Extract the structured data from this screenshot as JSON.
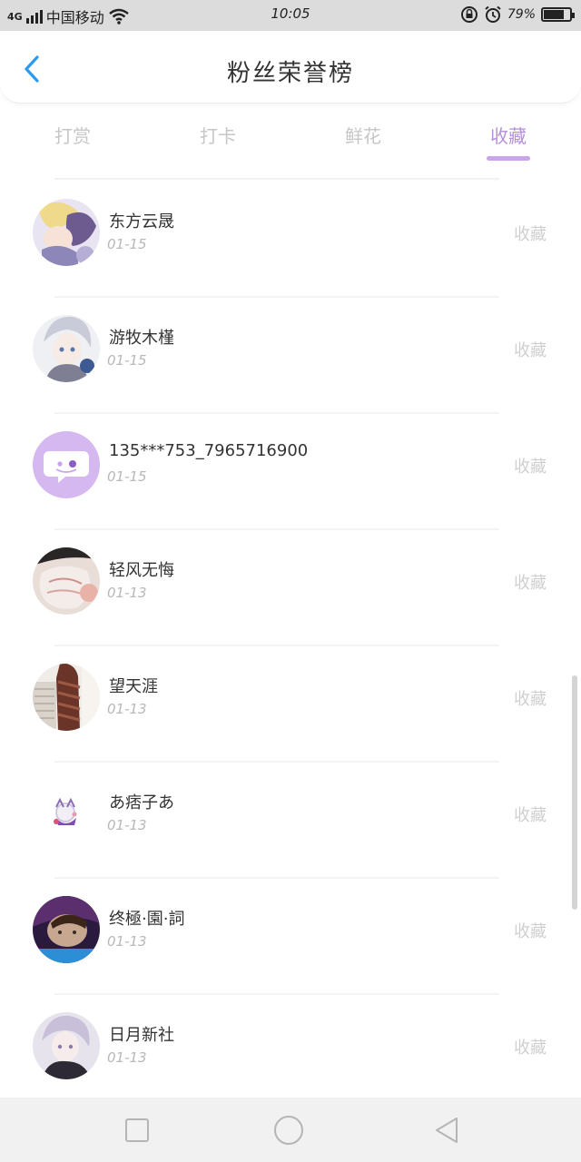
{
  "status_bar": {
    "signal": "4G",
    "carrier": "中国移动",
    "time": "10:05",
    "battery": "79%",
    "battery_level": 0.79
  },
  "header": {
    "title": "粉丝荣誉榜"
  },
  "tabs": [
    {
      "label": "打赏",
      "active": false
    },
    {
      "label": "打卡",
      "active": false
    },
    {
      "label": "鲜花",
      "active": false
    },
    {
      "label": "收藏",
      "active": true
    }
  ],
  "list": [
    {
      "name": "东方云晟",
      "date": "01-15",
      "action": "收藏",
      "avatar": "anime-blonde"
    },
    {
      "name": "游牧木槿",
      "date": "01-15",
      "action": "收藏",
      "avatar": "anime-silver"
    },
    {
      "name": "135***753_7965716900",
      "date": "01-15",
      "action": "收藏",
      "avatar": "default-chat"
    },
    {
      "name": "轻风无悔",
      "date": "01-13",
      "action": "收藏",
      "avatar": "photo-light"
    },
    {
      "name": "望天涯",
      "date": "01-13",
      "action": "收藏",
      "avatar": "photo-brown"
    },
    {
      "name": "あ痞子あ",
      "date": "01-13",
      "action": "收藏",
      "avatar": "cartoon-small"
    },
    {
      "name": "终極·園·詞",
      "date": "01-13",
      "action": "收藏",
      "avatar": "photo-dark"
    },
    {
      "name": "日月新社",
      "date": "01-13",
      "action": "收藏",
      "avatar": "anime-lavender"
    }
  ],
  "colors": {
    "accent": "#b58fd9",
    "back_arrow": "#2a9bf0",
    "inactive_tab": "#c6c6c6"
  }
}
